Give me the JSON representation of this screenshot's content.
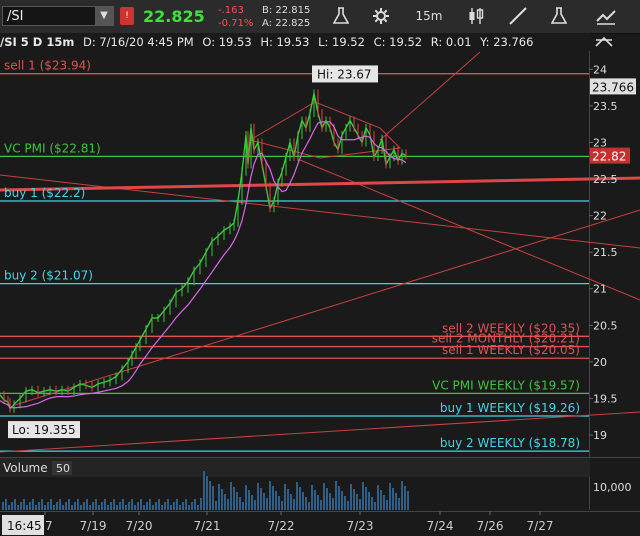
{
  "toolbar": {
    "symbol": "/SI",
    "symbol_dropdown": "▼",
    "alert_badge": "!",
    "last_price": "22.825",
    "net_change": "-.163",
    "pct_change": "-0.71%",
    "bid": "B: 22.815",
    "ask": "A: 22.825",
    "timeframe": "15m"
  },
  "header": {
    "symbol": "/SI 5 D 15m",
    "date": "D: 7/16/20 4:45 PM",
    "open": "O: 19.53",
    "high": "H: 19.53",
    "low": "L: 19.52",
    "close": "C: 19.52",
    "range": "R: 0.01",
    "y": "Y: 23.766"
  },
  "colors": {
    "background": "#1a1a1a",
    "up_candle": "#3ec43e",
    "down_candle": "#e04040",
    "sell_line": "#e05252",
    "buy_line": "#3fd6e8",
    "vc_line": "#3ec43e",
    "trend_line": "#e04040",
    "magenta_ma": "#d966e8"
  },
  "chart_data": {
    "type": "line",
    "ylim": [
      18.7,
      24.25
    ],
    "yticks": [
      "24",
      "23.5",
      "23",
      "22.5",
      "22",
      "21.5",
      "21",
      "20.5",
      "20",
      "19.5",
      "19"
    ],
    "xticks": [
      "17",
      "7/19",
      "7/20",
      "7/21",
      "7/22",
      "7/23",
      "7/24",
      "7/26",
      "7/27"
    ],
    "hi_label": "Hi: 23.67",
    "lo_label": "Lo: 19.355",
    "price_tag": "22.82",
    "y_tag": "23.766",
    "current_time": "16:45",
    "levels": [
      {
        "label": "sell 1 ($23.94)",
        "value": 23.94,
        "kind": "sell",
        "label_side": "left"
      },
      {
        "label": "VC PMI ($22.81)",
        "value": 22.81,
        "kind": "vc",
        "label_side": "left"
      },
      {
        "label": "buy 1 ($22.2)",
        "value": 22.2,
        "kind": "buy",
        "label_side": "left"
      },
      {
        "label": "buy 2 ($21.07)",
        "value": 21.07,
        "kind": "buy",
        "label_side": "left"
      },
      {
        "label": "sell 2 WEEKLY ($20.35)",
        "value": 20.35,
        "kind": "sell",
        "label_side": "right"
      },
      {
        "label": "sell 2 MONTHLY ($20.21)",
        "value": 20.21,
        "kind": "sell",
        "label_side": "right"
      },
      {
        "label": "sell 1 WEEKLY ($20.05)",
        "value": 20.05,
        "kind": "sell",
        "label_side": "right"
      },
      {
        "label": "VC PMI WEEKLY ($19.57)",
        "value": 19.57,
        "kind": "vc",
        "label_side": "right"
      },
      {
        "label": "buy 1 WEEKLY ($19.26)",
        "value": 19.26,
        "kind": "buy",
        "label_side": "right"
      },
      {
        "label": "buy 2 WEEKLY ($18.78)",
        "value": 18.78,
        "kind": "buy",
        "label_side": "right"
      }
    ],
    "price_series": [
      [
        0,
        19.55
      ],
      [
        4,
        19.48
      ],
      [
        8,
        19.45
      ],
      [
        10,
        19.36
      ],
      [
        14,
        19.42
      ],
      [
        20,
        19.5
      ],
      [
        26,
        19.6
      ],
      [
        32,
        19.62
      ],
      [
        38,
        19.58
      ],
      [
        44,
        19.6
      ],
      [
        50,
        19.62
      ],
      [
        56,
        19.6
      ],
      [
        62,
        19.62
      ],
      [
        68,
        19.6
      ],
      [
        74,
        19.65
      ],
      [
        80,
        19.7
      ],
      [
        86,
        19.68
      ],
      [
        92,
        19.65
      ],
      [
        98,
        19.7
      ],
      [
        104,
        19.72
      ],
      [
        110,
        19.75
      ],
      [
        116,
        19.8
      ],
      [
        122,
        19.9
      ],
      [
        128,
        20.0
      ],
      [
        132,
        20.1
      ],
      [
        136,
        20.2
      ],
      [
        140,
        20.3
      ],
      [
        146,
        20.45
      ],
      [
        152,
        20.6
      ],
      [
        158,
        20.6
      ],
      [
        164,
        20.7
      ],
      [
        170,
        20.8
      ],
      [
        176,
        20.95
      ],
      [
        182,
        21.0
      ],
      [
        188,
        21.1
      ],
      [
        194,
        21.25
      ],
      [
        200,
        21.35
      ],
      [
        206,
        21.5
      ],
      [
        212,
        21.65
      ],
      [
        218,
        21.72
      ],
      [
        224,
        21.8
      ],
      [
        230,
        21.85
      ],
      [
        234,
        21.9
      ],
      [
        238,
        22.2
      ],
      [
        242,
        22.6
      ],
      [
        246,
        23.1
      ],
      [
        248,
        22.7
      ],
      [
        251,
        23.2
      ],
      [
        254,
        22.9
      ],
      [
        258,
        23.0
      ],
      [
        262,
        22.7
      ],
      [
        266,
        22.4
      ],
      [
        270,
        22.1
      ],
      [
        274,
        22.2
      ],
      [
        278,
        22.45
      ],
      [
        282,
        22.6
      ],
      [
        286,
        22.8
      ],
      [
        290,
        23.0
      ],
      [
        294,
        22.8
      ],
      [
        298,
        23.1
      ],
      [
        302,
        23.3
      ],
      [
        306,
        23.2
      ],
      [
        310,
        23.4
      ],
      [
        314,
        23.67
      ],
      [
        318,
        23.4
      ],
      [
        322,
        23.2
      ],
      [
        326,
        23.3
      ],
      [
        330,
        23.2
      ],
      [
        334,
        23.0
      ],
      [
        338,
        22.9
      ],
      [
        342,
        23.1
      ],
      [
        346,
        23.2
      ],
      [
        350,
        23.3
      ],
      [
        354,
        23.2
      ],
      [
        358,
        23.1
      ],
      [
        362,
        23.0
      ],
      [
        366,
        23.2
      ],
      [
        370,
        23.1
      ],
      [
        374,
        22.8
      ],
      [
        378,
        22.9
      ],
      [
        382,
        23.05
      ],
      [
        386,
        22.7
      ],
      [
        390,
        22.8
      ],
      [
        394,
        22.9
      ],
      [
        398,
        22.75
      ],
      [
        402,
        22.85
      ],
      [
        406,
        22.82
      ]
    ],
    "volume": {
      "label": "Volume",
      "length": "50",
      "ytick": "10,000"
    }
  }
}
